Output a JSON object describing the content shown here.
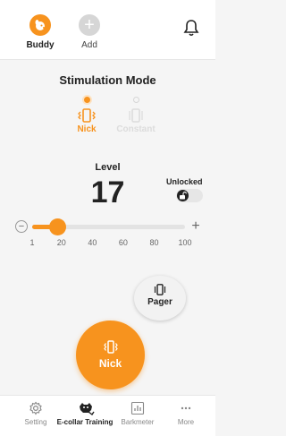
{
  "header": {
    "pets": [
      {
        "label": "Buddy",
        "icon": "dog-avatar-icon",
        "selected": true
      },
      {
        "label": "Add",
        "icon": "plus-icon"
      }
    ],
    "bell_icon": "bell-icon",
    "add_symbol": "+"
  },
  "stimulation": {
    "title": "Stimulation Mode",
    "modes": [
      {
        "label": "Nick",
        "icon": "vibrate-phone-icon",
        "selected": true
      },
      {
        "label": "Constant",
        "icon": "vibrate-phone-icon",
        "selected": false
      }
    ]
  },
  "level": {
    "label": "Level",
    "value": "17",
    "lock_label": "Unlocked",
    "lock_icon": "unlocked-padlock-icon"
  },
  "slider": {
    "minus": "−",
    "plus": "+",
    "min": 1,
    "max": 100,
    "value": 17,
    "ticks": [
      "1",
      "20",
      "40",
      "60",
      "80",
      "100"
    ]
  },
  "pager": {
    "label": "Pager",
    "icon": "vibrate-phone-icon"
  },
  "nick_button": {
    "label": "Nick",
    "icon": "vibrate-phone-icon"
  },
  "bottom_nav": [
    {
      "label": "Setting",
      "icon": "gear-icon",
      "active": false
    },
    {
      "label": "E-collar Training",
      "icon": "dog-training-icon",
      "active": true
    },
    {
      "label": "Barkmeter",
      "icon": "bar-chart-icon",
      "active": false
    },
    {
      "label": "More",
      "icon": "ellipsis-icon",
      "active": false
    }
  ],
  "colors": {
    "accent": "#f7931e",
    "inactive": "#d6d6d6",
    "text": "#222222"
  }
}
